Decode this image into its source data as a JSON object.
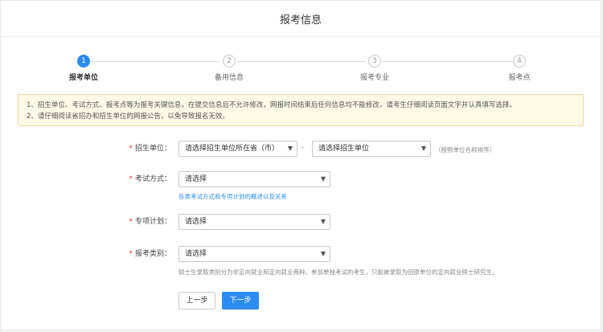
{
  "header": {
    "title": "报考信息"
  },
  "steps": [
    {
      "index": "1",
      "label": "报考单位"
    },
    {
      "index": "2",
      "label": "备用信息"
    },
    {
      "index": "3",
      "label": "报考专业"
    },
    {
      "index": "4",
      "label": "报考点"
    }
  ],
  "active_step": 1,
  "notice": {
    "line1": "1、招生单位、考试方式、报考点等为报考关键信息，在提交信息后不允许修改，网报时间结束后任何信息均不能修改，请考生仔细阅读页面文字并认真填写选择。",
    "line2": "2、请仔细阅读省招办和招生单位的网报公告，以免导致报名无效。"
  },
  "form": {
    "unit": {
      "label": "招生单位：",
      "province_value": "请选择招生单位所在省（市）",
      "separator": "-",
      "unit_value": "请选择招生单位",
      "hint": "（按照单位名称排序）"
    },
    "exam_method": {
      "label": "考试方式：",
      "value": "请选择",
      "link": "各类考试方式和专项计划的概述以及关系"
    },
    "special_plan": {
      "label": "专项计划：",
      "value": "请选择"
    },
    "category": {
      "label": "报考类别：",
      "value": "请选择",
      "hint": "硕士生录取类别分为非定向就业和定向就业两种。参加单独考试的考生，只能被录取为回原单位的定向就业硕士研究生。"
    },
    "required_mark": "*"
  },
  "buttons": {
    "prev": "上一步",
    "next": "下一步"
  },
  "colors": {
    "accent": "#2d8cf0",
    "required": "#e4393c",
    "notice_bg": "#fff9e6"
  },
  "icons": {
    "select_arrow": "chevron-down-icon"
  }
}
